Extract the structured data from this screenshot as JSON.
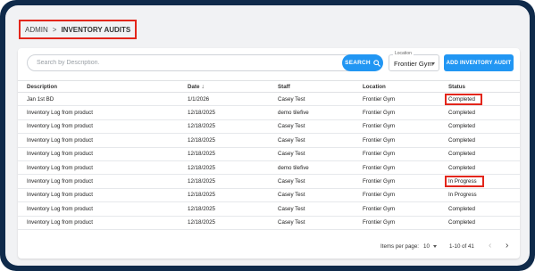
{
  "breadcrumb": {
    "root": "ADMIN",
    "separator": ">",
    "current": "INVENTORY AUDITS"
  },
  "toolbar": {
    "search_placeholder": "Search by Description.",
    "search_value": "",
    "search_button": "SEARCH",
    "location_label": "Location",
    "location_value": "Frontier Gym",
    "add_button": "ADD INVENTORY AUDIT"
  },
  "table": {
    "headers": {
      "description": "Description",
      "date": "Date",
      "staff": "Staff",
      "location": "Location",
      "status": "Status"
    },
    "sort_icon": "arrow-down",
    "rows": [
      {
        "description": "Jan 1st BD",
        "date": "1/1/2026",
        "staff": "Casey Test",
        "location": "Frontier Gym",
        "status": "Completed",
        "highlighted": true
      },
      {
        "description": "Inventory Log from product",
        "date": "12/18/2025",
        "staff": "demo tilefive",
        "location": "Frontier Gym",
        "status": "Completed",
        "highlighted": false
      },
      {
        "description": "Inventory Log from product",
        "date": "12/18/2025",
        "staff": "Casey Test",
        "location": "Frontier Gym",
        "status": "Completed",
        "highlighted": false
      },
      {
        "description": "Inventory Log from product",
        "date": "12/18/2025",
        "staff": "Casey Test",
        "location": "Frontier Gym",
        "status": "Completed",
        "highlighted": false
      },
      {
        "description": "Inventory Log from product",
        "date": "12/18/2025",
        "staff": "Casey Test",
        "location": "Frontier Gym",
        "status": "Completed",
        "highlighted": false
      },
      {
        "description": "Inventory Log from product",
        "date": "12/18/2025",
        "staff": "demo tilefive",
        "location": "Frontier Gym",
        "status": "Completed",
        "highlighted": false
      },
      {
        "description": "Inventory Log from product",
        "date": "12/18/2025",
        "staff": "Casey Test",
        "location": "Frontier Gym",
        "status": "In Progress",
        "highlighted": true
      },
      {
        "description": "Inventory Log from product",
        "date": "12/18/2025",
        "staff": "Casey Test",
        "location": "Frontier Gym",
        "status": "In Progress",
        "highlighted": false
      },
      {
        "description": "Inventory Log from product",
        "date": "12/18/2025",
        "staff": "Casey Test",
        "location": "Frontier Gym",
        "status": "Completed",
        "highlighted": false
      },
      {
        "description": "Inventory Log from product",
        "date": "12/18/2025",
        "staff": "Casey Test",
        "location": "Frontier Gym",
        "status": "Completed",
        "highlighted": false
      }
    ]
  },
  "paginator": {
    "items_per_page_label": "Items per page:",
    "items_per_page_value": "10",
    "range_label": "1-10 of 41"
  },
  "colors": {
    "accent": "#2196f3",
    "highlight_border": "#e3261b",
    "frame": "#0f2a4a"
  }
}
